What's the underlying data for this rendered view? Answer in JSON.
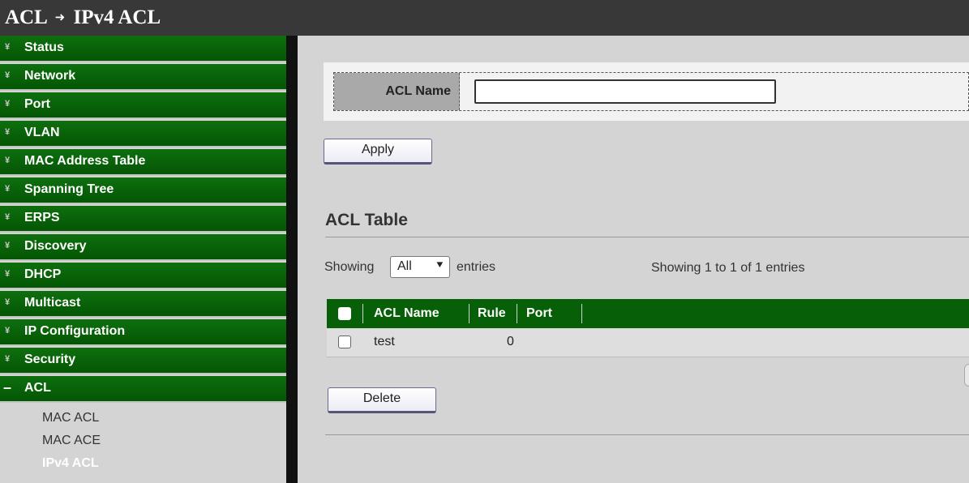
{
  "breadcrumb": {
    "section": "ACL",
    "arrow": "➜",
    "page": "IPv4 ACL"
  },
  "sidebar": {
    "items": [
      {
        "label": "Status",
        "icon": "double-chevron-down-icon"
      },
      {
        "label": "Network",
        "icon": "double-chevron-down-icon"
      },
      {
        "label": "Port",
        "icon": "double-chevron-down-icon"
      },
      {
        "label": "VLAN",
        "icon": "double-chevron-down-icon"
      },
      {
        "label": "MAC Address Table",
        "icon": "double-chevron-down-icon"
      },
      {
        "label": "Spanning Tree",
        "icon": "double-chevron-down-icon"
      },
      {
        "label": "ERPS",
        "icon": "double-chevron-down-icon"
      },
      {
        "label": "Discovery",
        "icon": "double-chevron-down-icon"
      },
      {
        "label": "DHCP",
        "icon": "double-chevron-down-icon"
      },
      {
        "label": "Multicast",
        "icon": "double-chevron-down-icon"
      },
      {
        "label": "IP Configuration",
        "icon": "double-chevron-down-icon"
      },
      {
        "label": "Security",
        "icon": "double-chevron-down-icon"
      },
      {
        "label": "ACL",
        "icon": "collapse-minus-icon",
        "expanded": true
      }
    ],
    "subitems": [
      {
        "label": "MAC ACL"
      },
      {
        "label": "MAC ACE"
      },
      {
        "label": "IPv4 ACL",
        "active": true
      }
    ],
    "icon_glyphs": {
      "collapsed": "¥",
      "expanded": "–"
    }
  },
  "form": {
    "acl_name_label": "ACL Name",
    "acl_name_value": "",
    "apply_label": "Apply"
  },
  "table_section": {
    "title": "ACL Table",
    "showing_prefix": "Showing",
    "page_size": "All",
    "entries_suffix": "entries",
    "summary": "Showing 1 to 1 of 1 entries",
    "columns": [
      "ACL Name",
      "Rule",
      "Port"
    ],
    "rows": [
      {
        "acl_name": "test",
        "rule": "0",
        "port": ""
      }
    ],
    "delete_label": "Delete"
  },
  "colors": {
    "sidebar_green": "#0e6f0e",
    "table_header": "#075f07",
    "topbar": "#383838"
  }
}
